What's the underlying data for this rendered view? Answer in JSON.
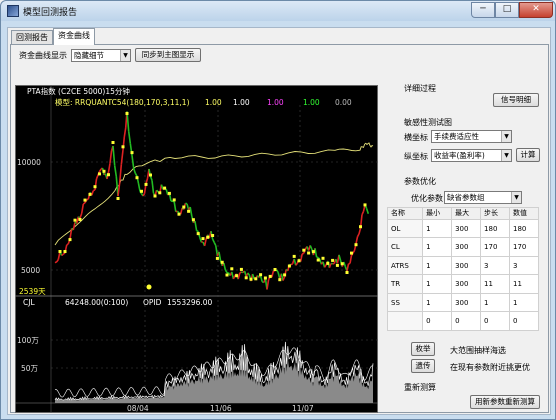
{
  "window": {
    "title": "模型回测报告",
    "min_label": "─",
    "max_label": "□",
    "close_label": "✕"
  },
  "tabs": [
    {
      "label": "回测报告",
      "active": false
    },
    {
      "label": "资金曲线",
      "active": true
    }
  ],
  "toolbar": {
    "curve_display_label": "资金曲线显示",
    "curve_display_value": "隐藏细节",
    "sync_button": "同步到主图显示"
  },
  "chart": {
    "header": "PTA指数 (C2CE 5000)15分钟",
    "model_label": "模型: RRQUANTC54(180,170,3,11,1)",
    "model_values": [
      "1.00",
      "1.00",
      "1.00",
      "1.00",
      "0.00"
    ],
    "model_value_colors": [
      "#ffff66",
      "#ffffff",
      "#ff44ff",
      "#33ff33",
      "#bbbbbb"
    ],
    "y_labels_main": [
      "10000",
      "5000"
    ],
    "days_label": "2539天",
    "vol_label": "CJL",
    "vol_value": "64248.00(0:100)",
    "opid_label": "OPID",
    "opid_value": "1553296.00",
    "y_labels_vol": [
      "100万",
      "50万"
    ],
    "x_labels": [
      "08/04",
      "11/06",
      "11/07"
    ]
  },
  "right_panel": {
    "detail_title": "详细过程",
    "signal_button": "信号明细",
    "sensitivity_title": "敏感性测试图",
    "x_axis_label": "横坐标",
    "x_axis_value": "手续费适应性",
    "y_axis_label": "纵坐标",
    "y_axis_value": "收益率(盈利率)",
    "calc_button": "计算",
    "optimize_title": "参数优化",
    "optimize_param_label": "优化参数",
    "optimize_param_value": "缺省参数组",
    "table_headers": [
      "名称",
      "最小",
      "最大",
      "步长",
      "数值"
    ],
    "table_rows": [
      [
        "OL",
        "1",
        "300",
        "180",
        "180"
      ],
      [
        "CL",
        "1",
        "300",
        "170",
        "170"
      ],
      [
        "ATRS",
        "1",
        "300",
        "3",
        "3"
      ],
      [
        "TR",
        "1",
        "300",
        "11",
        "11"
      ],
      [
        "SS",
        "1",
        "300",
        "1",
        "1"
      ],
      [
        "",
        "0",
        "0",
        "0",
        "0"
      ]
    ],
    "exhaust_button": "枚举",
    "exhaust_desc": "大范围抽样海选",
    "genetic_button": "遗传",
    "genetic_desc": "在现有参数附近挑更优",
    "retest_title": "重新测算",
    "retest_button": "用新参数重新测算"
  },
  "colors": {
    "equity_curve": "#e6e27a",
    "price_up": "#dd2222",
    "price_down": "#22bb22",
    "signal": "#ffff33",
    "volume": "#ffffff"
  }
}
